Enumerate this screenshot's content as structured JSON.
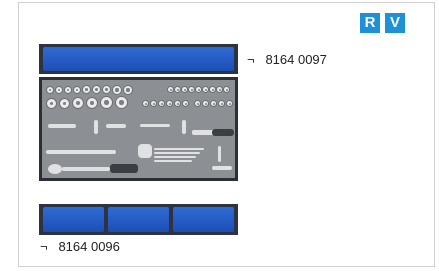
{
  "badges": {
    "r": "R",
    "v": "V"
  },
  "products": [
    {
      "symbol": "¬",
      "code": "8164 0097"
    },
    {
      "symbol": "¬",
      "code": "8164 0096"
    }
  ],
  "colors": {
    "badge": "#1e90d6",
    "foam_blue": "#2f6bd6",
    "tray_frame": "#2d3440",
    "tool_foam": "#8c8f93"
  },
  "icons": {
    "badge": "letter-badge-icon",
    "tray": "tool-tray-image"
  }
}
